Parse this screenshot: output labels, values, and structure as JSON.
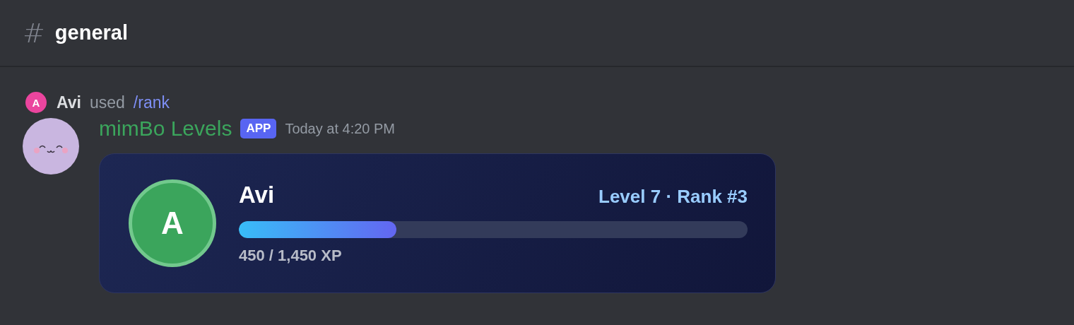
{
  "channel": {
    "icon": "#",
    "name": "general"
  },
  "command": {
    "avatar_letter": "A",
    "user": "Avi",
    "verb": "used",
    "command": "/rank"
  },
  "message": {
    "author": "mimBo Levels",
    "badge": "APP",
    "timestamp": "Today at 4:20 PM",
    "card": {
      "avatar_letter": "A",
      "name": "Avi",
      "stats": "Level 7 · Rank #3",
      "level": 0.31,
      "xp": "450 / 1,450 XP"
    }
  }
}
